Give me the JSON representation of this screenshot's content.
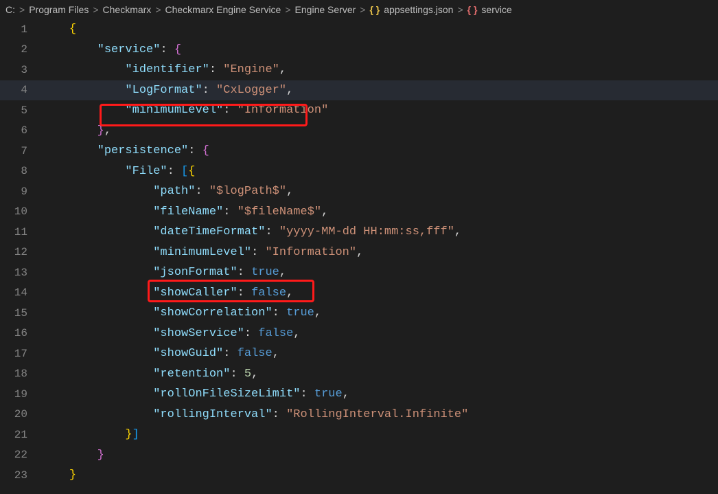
{
  "breadcrumb": {
    "items": [
      "C:",
      "Program Files",
      "Checkmarx",
      "Checkmarx Engine Service",
      "Engine Server",
      "appsettings.json",
      "service"
    ],
    "sep": ">"
  },
  "lines": [
    {
      "n": "1",
      "ind": 1,
      "segs": [
        {
          "cls": "tok-brace",
          "t": "{"
        }
      ]
    },
    {
      "n": "2",
      "ind": 2,
      "segs": [
        {
          "cls": "tok-key",
          "t": "\"service\""
        },
        {
          "cls": "tok-colon",
          "t": ": "
        },
        {
          "cls": "tok-brace2",
          "t": "{"
        }
      ]
    },
    {
      "n": "3",
      "ind": 3,
      "segs": [
        {
          "cls": "tok-key",
          "t": "\"identifier\""
        },
        {
          "cls": "tok-colon",
          "t": ": "
        },
        {
          "cls": "tok-str",
          "t": "\"Engine\""
        },
        {
          "cls": "tok-comma",
          "t": ","
        }
      ]
    },
    {
      "n": "4",
      "ind": 3,
      "hl": true,
      "segs": [
        {
          "cls": "tok-key",
          "t": "\"LogFormat\""
        },
        {
          "cls": "tok-colon",
          "t": ": "
        },
        {
          "cls": "tok-str",
          "t": "\"CxLogger\""
        },
        {
          "cls": "tok-comma",
          "t": ","
        }
      ]
    },
    {
      "n": "5",
      "ind": 3,
      "segs": [
        {
          "cls": "tok-key",
          "t": "\"minimumLevel\""
        },
        {
          "cls": "tok-colon",
          "t": ": "
        },
        {
          "cls": "tok-str",
          "t": "\"Information\""
        }
      ]
    },
    {
      "n": "6",
      "ind": 2,
      "segs": [
        {
          "cls": "tok-brace2",
          "t": "}"
        },
        {
          "cls": "tok-comma",
          "t": ","
        }
      ]
    },
    {
      "n": "7",
      "ind": 2,
      "segs": [
        {
          "cls": "tok-key",
          "t": "\"persistence\""
        },
        {
          "cls": "tok-colon",
          "t": ": "
        },
        {
          "cls": "tok-brace2",
          "t": "{"
        }
      ]
    },
    {
      "n": "8",
      "ind": 3,
      "segs": [
        {
          "cls": "tok-key",
          "t": "\"File\""
        },
        {
          "cls": "tok-colon",
          "t": ": "
        },
        {
          "cls": "tok-brace3",
          "t": "["
        },
        {
          "cls": "tok-brace",
          "t": "{"
        }
      ]
    },
    {
      "n": "9",
      "ind": 4,
      "segs": [
        {
          "cls": "tok-key",
          "t": "\"path\""
        },
        {
          "cls": "tok-colon",
          "t": ": "
        },
        {
          "cls": "tok-str",
          "t": "\"$logPath$\""
        },
        {
          "cls": "tok-comma",
          "t": ","
        }
      ]
    },
    {
      "n": "10",
      "ind": 4,
      "segs": [
        {
          "cls": "tok-key",
          "t": "\"fileName\""
        },
        {
          "cls": "tok-colon",
          "t": ": "
        },
        {
          "cls": "tok-str",
          "t": "\"$fileName$\""
        },
        {
          "cls": "tok-comma",
          "t": ","
        }
      ]
    },
    {
      "n": "11",
      "ind": 4,
      "segs": [
        {
          "cls": "tok-key",
          "t": "\"dateTimeFormat\""
        },
        {
          "cls": "tok-colon",
          "t": ": "
        },
        {
          "cls": "tok-str",
          "t": "\"yyyy-MM-dd HH:mm:ss,fff\""
        },
        {
          "cls": "tok-comma",
          "t": ","
        }
      ]
    },
    {
      "n": "12",
      "ind": 4,
      "segs": [
        {
          "cls": "tok-key",
          "t": "\"minimumLevel\""
        },
        {
          "cls": "tok-colon",
          "t": ": "
        },
        {
          "cls": "tok-str",
          "t": "\"Information\""
        },
        {
          "cls": "tok-comma",
          "t": ","
        }
      ]
    },
    {
      "n": "13",
      "ind": 4,
      "segs": [
        {
          "cls": "tok-key",
          "t": "\"jsonFormat\""
        },
        {
          "cls": "tok-colon",
          "t": ": "
        },
        {
          "cls": "tok-bool",
          "t": "true"
        },
        {
          "cls": "tok-comma",
          "t": ","
        }
      ]
    },
    {
      "n": "14",
      "ind": 4,
      "segs": [
        {
          "cls": "tok-key",
          "t": "\"showCaller\""
        },
        {
          "cls": "tok-colon",
          "t": ": "
        },
        {
          "cls": "tok-bool",
          "t": "false"
        },
        {
          "cls": "tok-comma",
          "t": ","
        }
      ]
    },
    {
      "n": "15",
      "ind": 4,
      "segs": [
        {
          "cls": "tok-key",
          "t": "\"showCorrelation\""
        },
        {
          "cls": "tok-colon",
          "t": ": "
        },
        {
          "cls": "tok-bool",
          "t": "true"
        },
        {
          "cls": "tok-comma",
          "t": ","
        }
      ]
    },
    {
      "n": "16",
      "ind": 4,
      "segs": [
        {
          "cls": "tok-key",
          "t": "\"showService\""
        },
        {
          "cls": "tok-colon",
          "t": ": "
        },
        {
          "cls": "tok-bool",
          "t": "false"
        },
        {
          "cls": "tok-comma",
          "t": ","
        }
      ]
    },
    {
      "n": "17",
      "ind": 4,
      "segs": [
        {
          "cls": "tok-key",
          "t": "\"showGuid\""
        },
        {
          "cls": "tok-colon",
          "t": ": "
        },
        {
          "cls": "tok-bool",
          "t": "false"
        },
        {
          "cls": "tok-comma",
          "t": ","
        }
      ]
    },
    {
      "n": "18",
      "ind": 4,
      "segs": [
        {
          "cls": "tok-key",
          "t": "\"retention\""
        },
        {
          "cls": "tok-colon",
          "t": ": "
        },
        {
          "cls": "tok-num",
          "t": "5"
        },
        {
          "cls": "tok-comma",
          "t": ","
        }
      ]
    },
    {
      "n": "19",
      "ind": 4,
      "segs": [
        {
          "cls": "tok-key",
          "t": "\"rollOnFileSizeLimit\""
        },
        {
          "cls": "tok-colon",
          "t": ": "
        },
        {
          "cls": "tok-bool",
          "t": "true"
        },
        {
          "cls": "tok-comma",
          "t": ","
        }
      ]
    },
    {
      "n": "20",
      "ind": 4,
      "segs": [
        {
          "cls": "tok-key",
          "t": "\"rollingInterval\""
        },
        {
          "cls": "tok-colon",
          "t": ": "
        },
        {
          "cls": "tok-str",
          "t": "\"RollingInterval.Infinite\""
        }
      ]
    },
    {
      "n": "21",
      "ind": 3,
      "segs": [
        {
          "cls": "tok-brace",
          "t": "}"
        },
        {
          "cls": "tok-brace3",
          "t": "]"
        }
      ]
    },
    {
      "n": "22",
      "ind": 2,
      "segs": [
        {
          "cls": "tok-brace2",
          "t": "}"
        }
      ]
    },
    {
      "n": "23",
      "ind": 1,
      "segs": [
        {
          "cls": "tok-brace",
          "t": "}"
        }
      ]
    }
  ],
  "indentUnit": "    "
}
